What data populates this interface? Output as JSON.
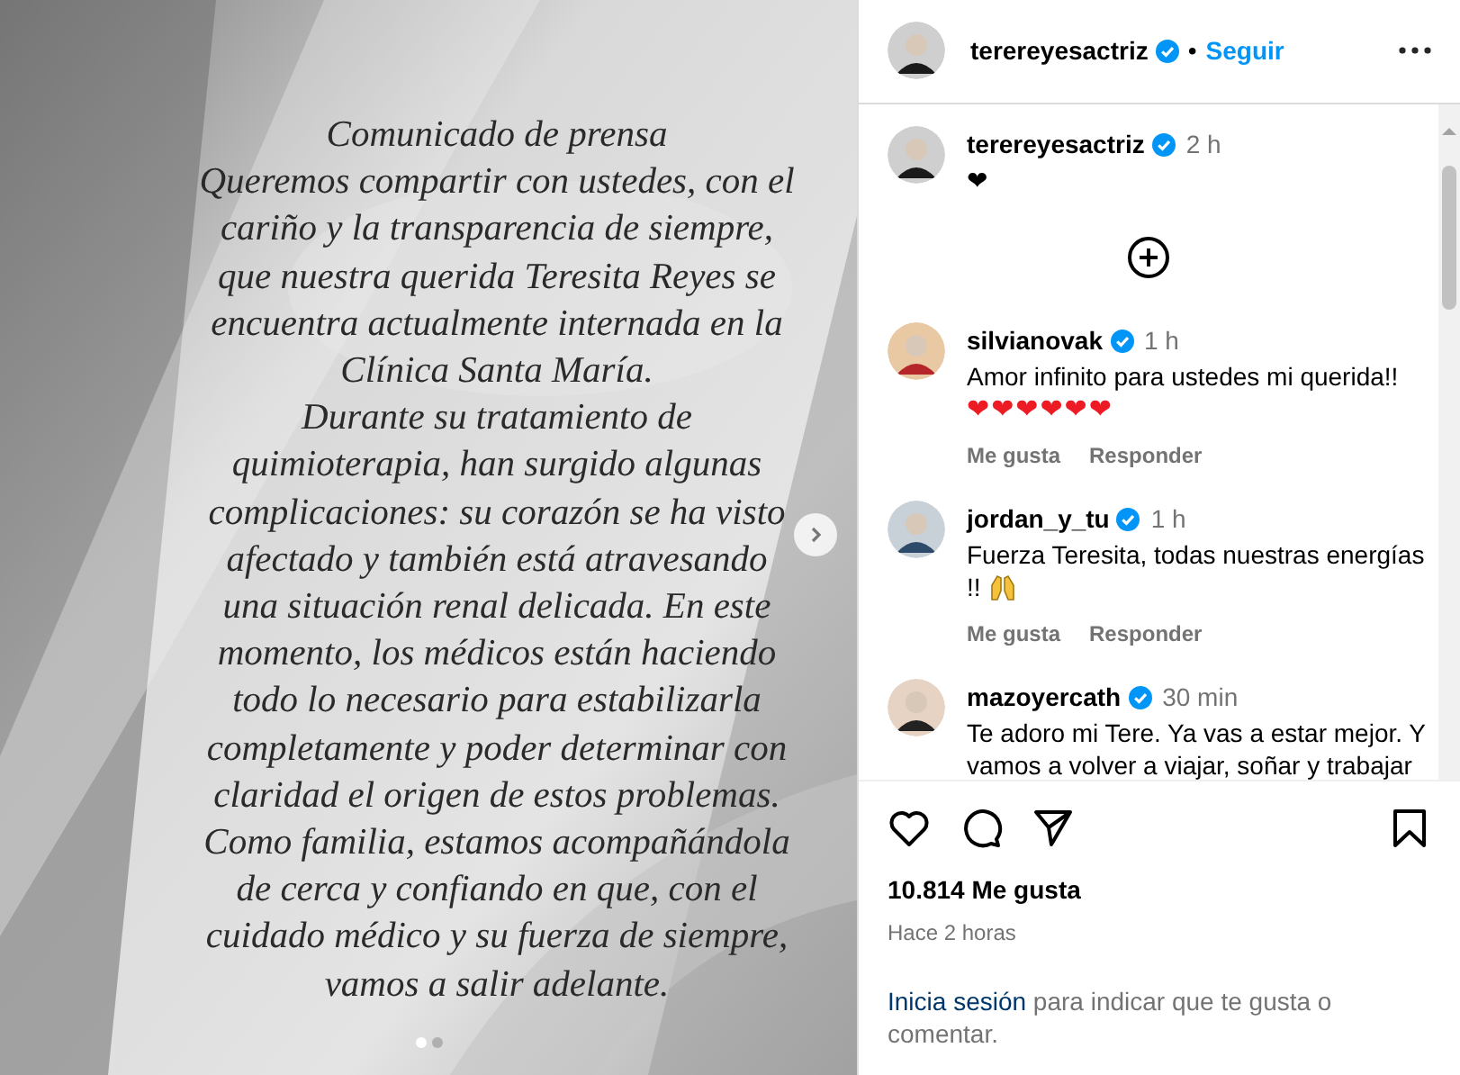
{
  "post_image": {
    "lines": [
      "Comunicado de prensa",
      "Queremos compartir con ustedes, con el",
      "cariño y la transparencia de siempre,",
      "que nuestra querida Teresita Reyes se",
      "encuentra actualmente internada en la",
      "Clínica Santa María.",
      "Durante su tratamiento de",
      "quimioterapia, han surgido algunas",
      "complicaciones: su corazón se ha visto",
      "afectado y también está atravesando",
      "una situación renal delicada. En este",
      "momento, los médicos están haciendo",
      "todo lo necesario para estabilizarla",
      "completamente y poder determinar con",
      "claridad el origen de estos problemas.",
      "Como familia, estamos acompañándola",
      "de cerca y confiando en que, con el",
      "cuidado médico y su fuerza de siempre,",
      "vamos a salir adelante."
    ],
    "slides": [
      {
        "selected": true
      },
      {
        "selected": false
      }
    ]
  },
  "header": {
    "username": "terereyesactriz",
    "verified": true,
    "separator": "•",
    "follow": "Seguir"
  },
  "caption": {
    "username": "terereyesactriz",
    "verified": true,
    "time": "2 h",
    "text": "❤"
  },
  "comments": [
    {
      "kind": "hearts",
      "username": "silvianovak",
      "verified": true,
      "time": "1 h",
      "text": "Amor infinito para ustedes mi querida!!",
      "hearts": "❤❤❤❤❤❤",
      "actions": [
        "Me gusta",
        "Responder"
      ]
    },
    {
      "kind": "hands",
      "username": "jordan_y_tu",
      "verified": true,
      "time": "1 h",
      "text": "Fuerza Teresita, todas nuestras energías !!",
      "actions": [
        "Me gusta",
        "Responder"
      ]
    },
    {
      "kind": "plain",
      "username": "mazoyercath",
      "verified": true,
      "time": "30 min",
      "text": "Te adoro mi Tere. Ya vas a estar mejor. Y vamos a volver a viajar, soñar y trabajar"
    }
  ],
  "likes": "10.814 Me gusta",
  "posted": "Hace 2 horas",
  "login": {
    "link": "Inicia sesión",
    "text": "para indicar que te gusta o comentar."
  }
}
